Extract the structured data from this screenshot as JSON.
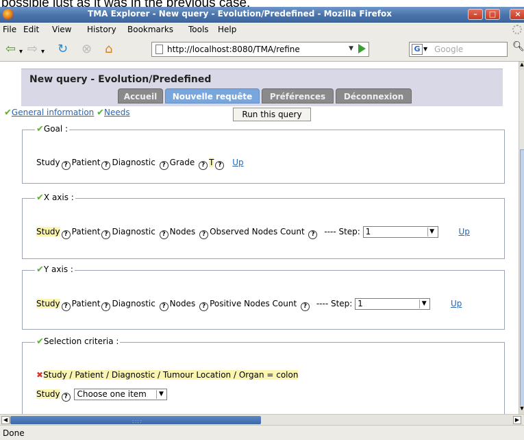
{
  "caption_overlay": "possible just as it was in the previous case.",
  "window": {
    "title": "TMA Explorer - New query - Evolution/Predefined - Mozilla Firefox",
    "min_label": "–",
    "max_label": "□",
    "close_label": "×"
  },
  "menu": {
    "file": "File",
    "edit": "Edit",
    "view": "View",
    "history": "History",
    "bookmarks": "Bookmarks",
    "tools": "Tools",
    "help": "Help"
  },
  "navbar": {
    "url": "http://localhost:8080/TMA/refine",
    "search_placeholder": "Google"
  },
  "page": {
    "title": "New query - Evolution/Predefined",
    "tabs": {
      "accueil": "Accueil",
      "nouvelle": "Nouvelle requête",
      "preferences": "Préférences",
      "deconnexion": "Déconnexion"
    },
    "links": {
      "general": "General information",
      "needs": "Needs"
    },
    "run_button": "Run this query",
    "goal": {
      "legend": "Goal :",
      "study": "Study",
      "patient": "Patient",
      "diagnostic": "Diagnostic",
      "grade": "Grade",
      "t": "T",
      "up": "Up"
    },
    "x_axis": {
      "legend": "X axis :",
      "study": "Study",
      "patient": "Patient",
      "diagnostic": "Diagnostic",
      "nodes": "Nodes",
      "field": "Observed Nodes Count",
      "step_label": "---- Step:",
      "step_value": "1",
      "up": "Up"
    },
    "y_axis": {
      "legend": "Y axis :",
      "study": "Study",
      "patient": "Patient",
      "diagnostic": "Diagnostic",
      "nodes": "Nodes",
      "field": "Positive Nodes Count",
      "step_label": "---- Step:",
      "step_value": "1",
      "up": "Up"
    },
    "criteria": {
      "legend": "Selection criteria :",
      "criterion": "Study / Patient / Diagnostic / Tumour Location / Organ = colon",
      "study": "Study",
      "select_value": "Choose one item"
    }
  },
  "status": {
    "text": "Done"
  }
}
